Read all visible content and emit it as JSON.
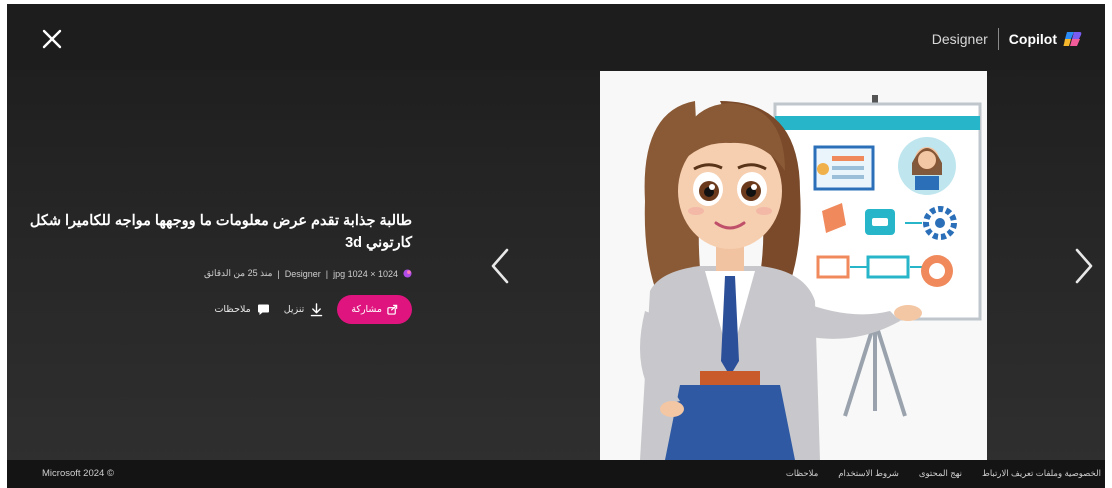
{
  "header": {
    "designer_label": "Designer",
    "copilot_label": "Copilot"
  },
  "image": {
    "title": "طالبة جذابة تقدم عرض معلومات ما ووجهها مواجه للكاميرا شكل كارتوني 3d",
    "source": "Designer",
    "dimensions": "1024 × 1024 jpg",
    "time": "منذ 25 من الدقائق"
  },
  "actions": {
    "share_label": "مشاركة",
    "download_label": "تنزيل",
    "feedback_label": "ملاحظات"
  },
  "footer": {
    "copyright": "Microsoft 2024 ©",
    "links": [
      "الخصوصية وملفات تعريف الارتباط",
      "نهج المحتوى",
      "شروط الاستخدام",
      "ملاحظات"
    ]
  },
  "colors": {
    "accent": "#e0147f",
    "background": "#262626",
    "topbar": "#1d1d1d",
    "footer": "#141414"
  },
  "icons": [
    "close-icon",
    "copilot-logo-icon",
    "chevron-left-icon",
    "chevron-right-icon",
    "designer-logo-icon",
    "share-icon",
    "download-icon",
    "feedback-icon"
  ]
}
